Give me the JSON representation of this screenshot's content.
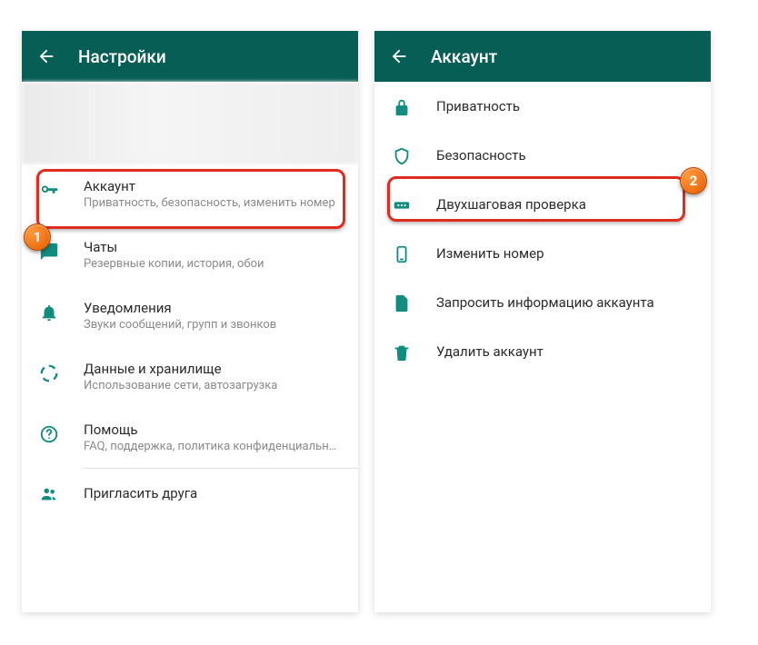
{
  "colors": {
    "header_bg": "#075E54",
    "accent": "#128C7E",
    "highlight": "#e02b20"
  },
  "left": {
    "header_title": "Настройки",
    "items": [
      {
        "icon": "key",
        "label": "Аккаунт",
        "sub": "Приватность, безопасность, изменить номер"
      },
      {
        "icon": "chat",
        "label": "Чаты",
        "sub": "Резервные копии, история, обои"
      },
      {
        "icon": "bell",
        "label": "Уведомления",
        "sub": "Звуки сообщений, групп и звонков"
      },
      {
        "icon": "data",
        "label": "Данные и хранилище",
        "sub": "Использование сети, автозагрузка"
      },
      {
        "icon": "help",
        "label": "Помощь",
        "sub": "FAQ, поддержка, политика конфиденциально…"
      },
      {
        "icon": "people",
        "label": "Пригласить друга"
      }
    ],
    "badge": "1"
  },
  "right": {
    "header_title": "Аккаунт",
    "items": [
      {
        "icon": "lock",
        "label": "Приватность"
      },
      {
        "icon": "shield",
        "label": "Безопасность"
      },
      {
        "icon": "dots",
        "label": "Двухшаговая проверка"
      },
      {
        "icon": "phone",
        "label": "Изменить номер"
      },
      {
        "icon": "doc",
        "label": "Запросить информацию аккаунта"
      },
      {
        "icon": "trash",
        "label": "Удалить аккаунт"
      }
    ],
    "badge": "2"
  }
}
